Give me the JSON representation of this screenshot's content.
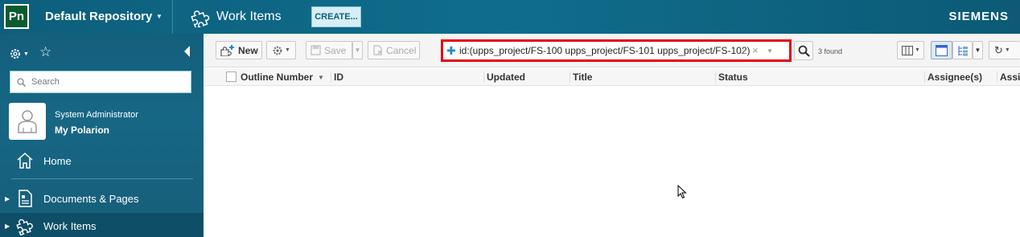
{
  "topbar": {
    "logo_text": "Pn",
    "repository": "Default Repository",
    "page_title": "Work Items",
    "create_label": "CREATE...",
    "brand": "SIEMENS"
  },
  "sidebar": {
    "search_placeholder": "Search",
    "user_name": "System Administrator",
    "user_link": "My Polarion",
    "items": [
      {
        "label": "Home",
        "icon": "home-icon"
      },
      {
        "label": "Documents & Pages",
        "icon": "document-icon"
      },
      {
        "label": "Work Items",
        "icon": "puzzle-icon"
      }
    ]
  },
  "toolbar": {
    "new_label": "New",
    "save_label": "Save",
    "cancel_label": "Cancel",
    "query": "id:(upps_project/FS-100 upps_project/FS-101 upps_project/FS-102)",
    "found": "3 found"
  },
  "table": {
    "columns": [
      "Outline Number",
      "ID",
      "Updated",
      "Title",
      "Status",
      "Assignee(s)",
      "Assig"
    ]
  },
  "colors": {
    "topbar": "#0f6d8c",
    "sidebar": "#166785",
    "query_highlight": "#e30613",
    "logo_bg": "#0a5b2f"
  }
}
